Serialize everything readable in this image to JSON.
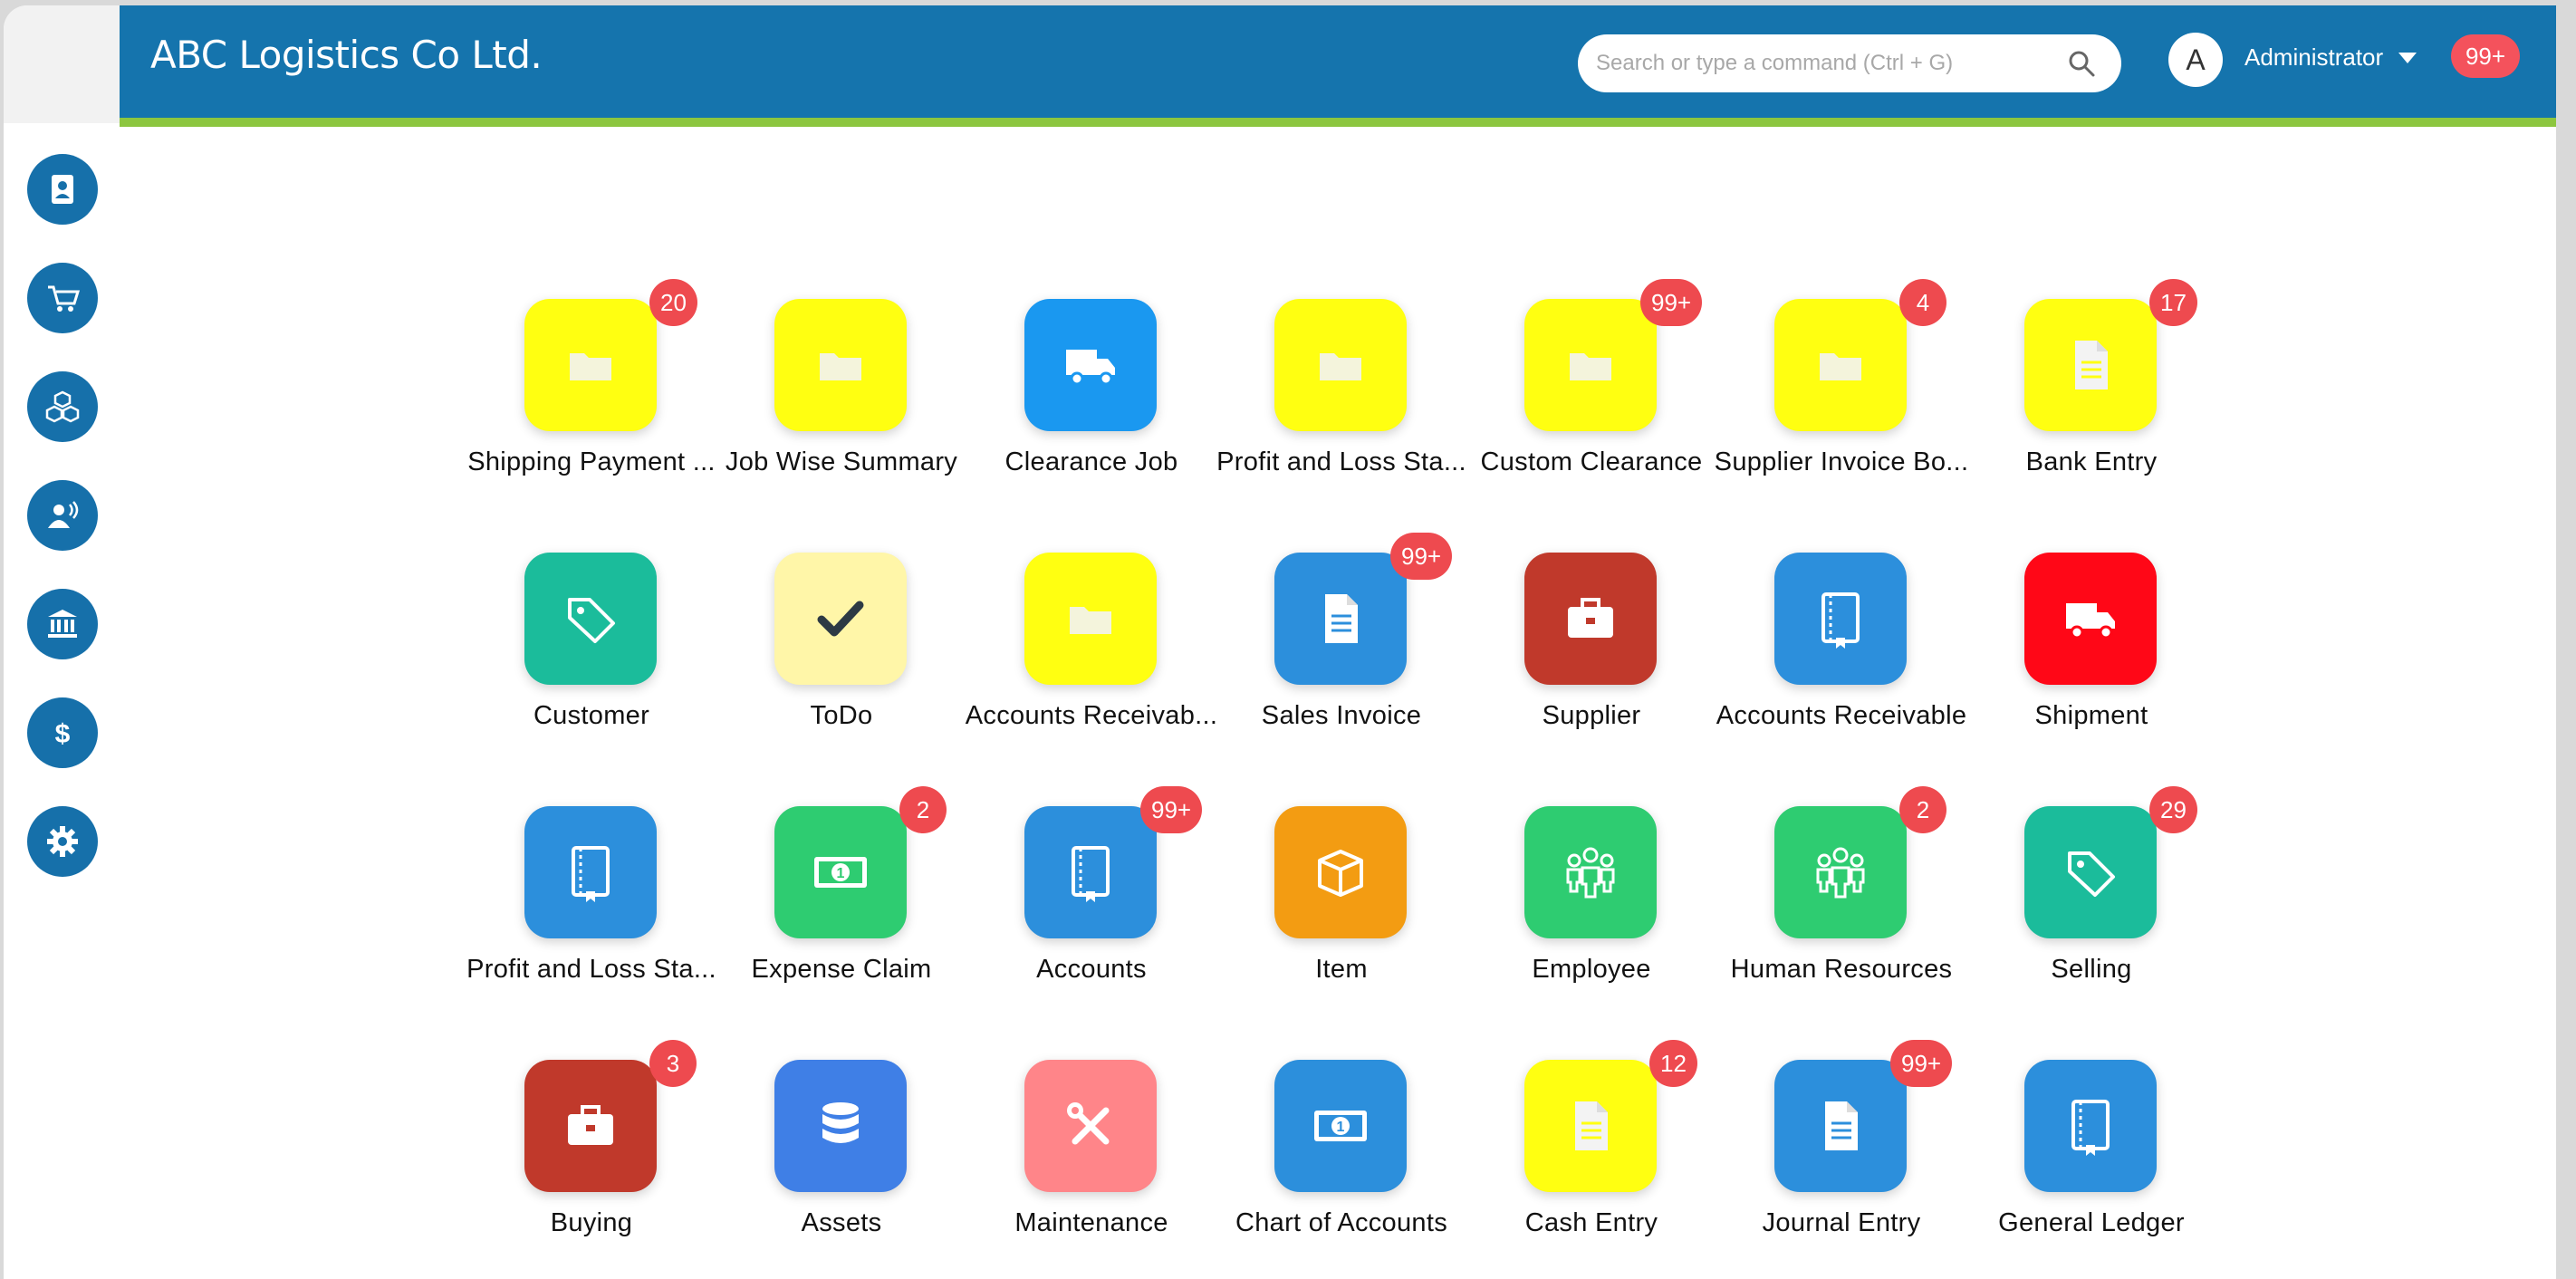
{
  "header": {
    "title": "ABC Logistics Co Ltd.",
    "search_placeholder": "Search or type a command (Ctrl + G)",
    "avatar_initial": "A",
    "user_name": "Administrator",
    "notification_count": "99+"
  },
  "sidebar": {
    "items": [
      {
        "icon": "contact-book-icon"
      },
      {
        "icon": "cart-icon"
      },
      {
        "icon": "boxes-icon"
      },
      {
        "icon": "user-voice-icon"
      },
      {
        "icon": "bank-icon"
      },
      {
        "icon": "dollar-icon"
      },
      {
        "icon": "gear-icon"
      }
    ]
  },
  "colors": {
    "header": "#1574ad",
    "header_stripe": "#8cc63f",
    "badge": "#ee4a4f",
    "yellow": "#ffff11",
    "pale_yellow": "#fff6a8",
    "blue": "#2c8fdc",
    "azure": "#1a98f0",
    "teal": "#1bbc9b",
    "green": "#2ecc71",
    "dark_red": "#c0392b",
    "red": "#ff0717",
    "orange": "#f39c12",
    "royal_blue": "#3f7fe6",
    "pink": "#ff8589"
  },
  "tiles": [
    {
      "label": "Shipping Payment ...",
      "icon": "folder-icon",
      "color": "#ffff11",
      "badge": "20"
    },
    {
      "label": "Job Wise Summary",
      "icon": "folder-icon",
      "color": "#ffff11",
      "badge": ""
    },
    {
      "label": "Clearance Job",
      "icon": "truck-icon",
      "color": "#1a98f0",
      "badge": ""
    },
    {
      "label": "Profit and Loss Sta...",
      "icon": "folder-icon",
      "color": "#ffff11",
      "badge": ""
    },
    {
      "label": "Custom Clearance",
      "icon": "folder-icon",
      "color": "#ffff11",
      "badge": "99+"
    },
    {
      "label": "Supplier Invoice Bo...",
      "icon": "folder-icon",
      "color": "#ffff11",
      "badge": "4"
    },
    {
      "label": "Bank Entry",
      "icon": "document-icon",
      "color": "#ffff11",
      "badge": "17"
    },
    {
      "label": "Customer",
      "icon": "tag-icon",
      "color": "#1bbc9b",
      "badge": ""
    },
    {
      "label": "ToDo",
      "icon": "check-icon",
      "color": "#fff6a8",
      "badge": ""
    },
    {
      "label": "Accounts Receivab...",
      "icon": "folder-icon",
      "color": "#ffff11",
      "badge": ""
    },
    {
      "label": "Sales Invoice",
      "icon": "document-icon",
      "color": "#2c8fdc",
      "badge": "99+"
    },
    {
      "label": "Supplier",
      "icon": "briefcase-icon",
      "color": "#c0392b",
      "badge": ""
    },
    {
      "label": "Accounts Receivable",
      "icon": "book-icon",
      "color": "#2c8fdc",
      "badge": ""
    },
    {
      "label": "Shipment",
      "icon": "truck-icon",
      "color": "#ff0717",
      "badge": ""
    },
    {
      "label": "Profit and Loss Sta...",
      "icon": "book-icon",
      "color": "#2c8fdc",
      "badge": ""
    },
    {
      "label": "Expense Claim",
      "icon": "money-icon",
      "color": "#2ecc71",
      "badge": "2"
    },
    {
      "label": "Accounts",
      "icon": "book-icon",
      "color": "#2c8fdc",
      "badge": "99+"
    },
    {
      "label": "Item",
      "icon": "box-icon",
      "color": "#f39c12",
      "badge": ""
    },
    {
      "label": "Employee",
      "icon": "people-icon",
      "color": "#2ecc71",
      "badge": ""
    },
    {
      "label": "Human Resources",
      "icon": "people-icon",
      "color": "#2ecc71",
      "badge": "2"
    },
    {
      "label": "Selling",
      "icon": "tag-icon",
      "color": "#1bbc9b",
      "badge": "29"
    },
    {
      "label": "Buying",
      "icon": "briefcase-icon",
      "color": "#c0392b",
      "badge": "3"
    },
    {
      "label": "Assets",
      "icon": "database-icon",
      "color": "#3f7fe6",
      "badge": ""
    },
    {
      "label": "Maintenance",
      "icon": "tools-icon",
      "color": "#ff8589",
      "badge": ""
    },
    {
      "label": "Chart of Accounts",
      "icon": "money-icon",
      "color": "#2c8fdc",
      "badge": ""
    },
    {
      "label": "Cash Entry",
      "icon": "document-icon",
      "color": "#ffff11",
      "badge": "12"
    },
    {
      "label": "Journal Entry",
      "icon": "document-icon",
      "color": "#2c8fdc",
      "badge": "99+"
    },
    {
      "label": "General Ledger",
      "icon": "book-icon",
      "color": "#2c8fdc",
      "badge": ""
    }
  ]
}
